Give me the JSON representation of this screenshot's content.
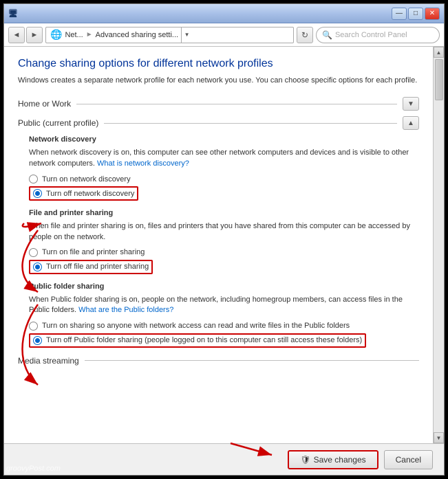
{
  "titleBar": {
    "title": "Advanced sharing setti...",
    "minBtn": "—",
    "maxBtn": "□",
    "closeBtn": "✕"
  },
  "addressBar": {
    "breadcrumb1": "Net...",
    "breadcrumb2": "Advanced sharing setti...",
    "searchPlaceholder": "Search Control Panel",
    "refreshIcon": "↻"
  },
  "page": {
    "title": "Change sharing options for different network profiles",
    "subtitle": "Windows creates a separate network profile for each network you use. You can choose specific options for each profile.",
    "homeWorkSection": "Home or Work",
    "publicSection": "Public (current profile)",
    "networkDiscovery": {
      "title": "Network discovery",
      "description": "When network discovery is on, this computer can see other network computers and devices and is visible to other network computers.",
      "link": "What is network discovery?",
      "option1": "Turn on network discovery",
      "option2": "Turn off network discovery"
    },
    "filePrinterSharing": {
      "title": "File and printer sharing",
      "description": "When file and printer sharing is on, files and printers that you have shared from this computer can be accessed by people on the network.",
      "option1": "Turn on file and printer sharing",
      "option2": "Turn off file and printer sharing"
    },
    "publicFolderSharing": {
      "title": "Public folder sharing",
      "description": "When Public folder sharing is on, people on the network, including homegroup members, can access files in the Public folders.",
      "link": "What are the Public folders?",
      "option1": "Turn on sharing so anyone with network access can read and write files in the Public folders",
      "option2": "Turn off Public folder sharing (people logged on to this computer can still access these folders)"
    },
    "mediaStreaming": {
      "title": "Media streaming"
    }
  },
  "footer": {
    "saveBtn": "Save changes",
    "cancelBtn": "Cancel",
    "saveIcon": "💾"
  },
  "watermark": "groovyPost.com"
}
